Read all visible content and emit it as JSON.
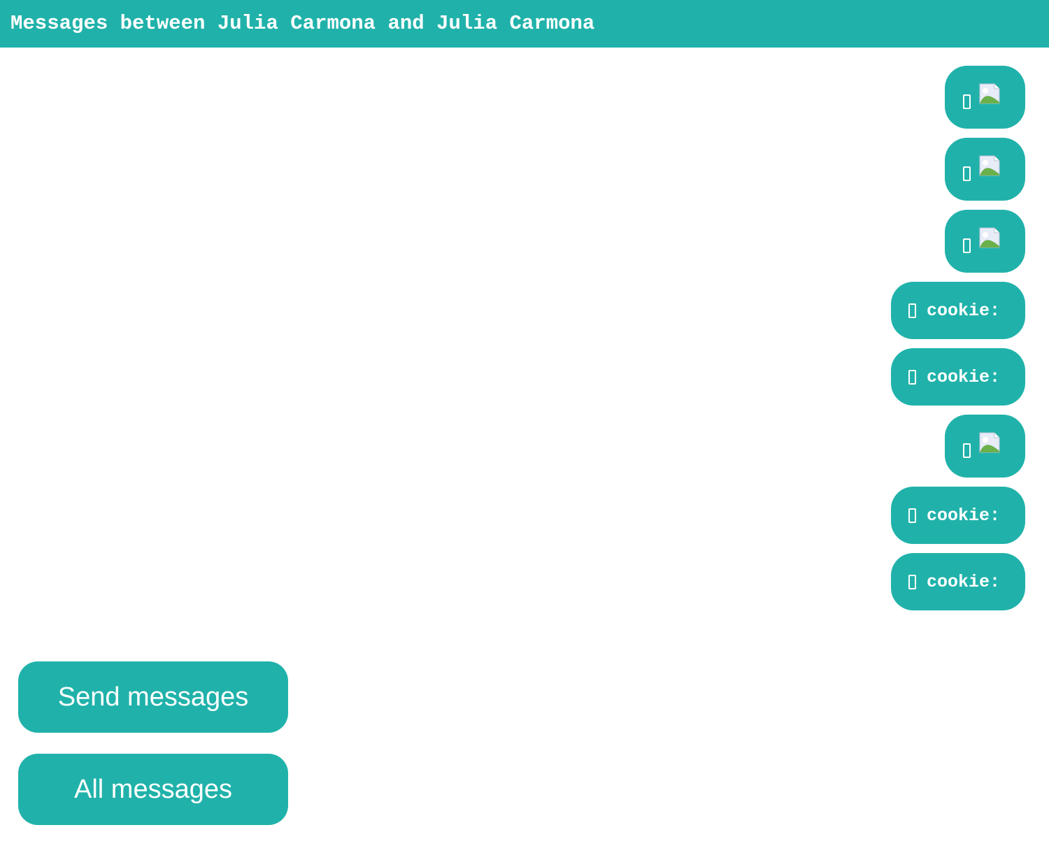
{
  "header": {
    "title": "Messages between Julia Carmona and Julia Carmona"
  },
  "messages": [
    {
      "type": "image",
      "icon": "image-placeholder-icon"
    },
    {
      "type": "image",
      "icon": "image-placeholder-icon"
    },
    {
      "type": "image",
      "icon": "image-placeholder-icon"
    },
    {
      "type": "text",
      "text": "cookie:"
    },
    {
      "type": "text",
      "text": "cookie:"
    },
    {
      "type": "image",
      "icon": "image-placeholder-icon"
    },
    {
      "type": "text",
      "text": "cookie:"
    },
    {
      "type": "text",
      "text": "cookie:"
    }
  ],
  "actions": {
    "send_label": "Send messages",
    "all_label": "All messages"
  },
  "colors": {
    "accent": "#20b2aa",
    "text": "#ffffff",
    "background": "#ffffff"
  }
}
